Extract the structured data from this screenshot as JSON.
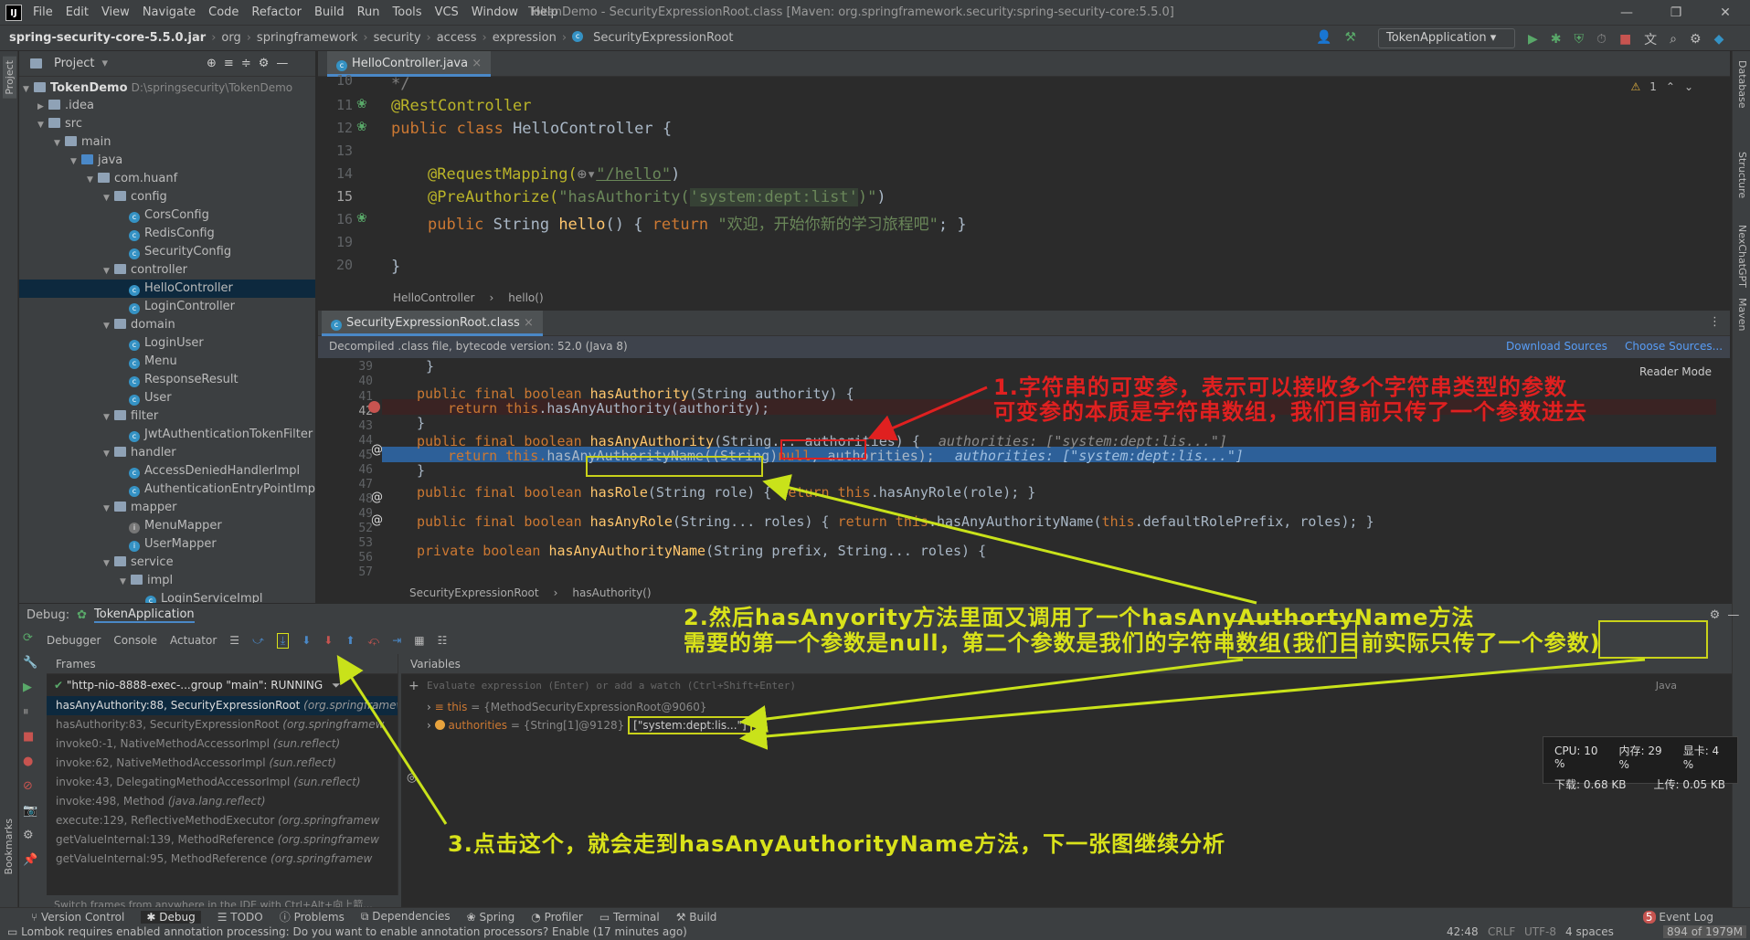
{
  "titlebar": {
    "logo": "IJ",
    "menus": [
      "File",
      "Edit",
      "View",
      "Navigate",
      "Code",
      "Refactor",
      "Build",
      "Run",
      "Tools",
      "VCS",
      "Window",
      "Help"
    ],
    "title": "TokenDemo - SecurityExpressionRoot.class [Maven: org.springframework.security:spring-security-core:5.5.0]"
  },
  "navbar": {
    "crumbs": [
      "spring-security-core-5.5.0.jar",
      "org",
      "springframework",
      "security",
      "access",
      "expression",
      "SecurityExpressionRoot"
    ],
    "run_config": "TokenApplication"
  },
  "project": {
    "title": "Project",
    "root": "TokenDemo",
    "root_path": "D:\\springsecurity\\TokenDemo",
    "items": [
      ".idea",
      "src",
      "main",
      "java",
      "com.huanf",
      "config",
      "CorsConfig",
      "RedisConfig",
      "SecurityConfig",
      "controller",
      "HelloController",
      "LoginController",
      "domain",
      "LoginUser",
      "Menu",
      "ResponseResult",
      "User",
      "filter",
      "JwtAuthenticationTokenFilter",
      "handler",
      "AccessDeniedHandlerImpl",
      "AuthenticationEntryPointImpl",
      "mapper",
      "MenuMapper",
      "UserMapper",
      "service",
      "impl",
      "LoginServiceImpl"
    ]
  },
  "editor1": {
    "tab": "HelloController.java",
    "lines": [
      "10",
      "11",
      "12",
      "13",
      "14",
      "15",
      "16",
      "19",
      "20"
    ],
    "code": {
      "l10": "*/",
      "l11": "@RestController",
      "l12a": "public class",
      "l12b": " HelloController {",
      "l14a": "@RequestMapping(",
      "l14b": "\"/hello\"",
      "l14c": ")",
      "l15a": "@PreAuthorize(",
      "l15b": "\"hasAuthority(",
      "l15c": "'system:dept:list'",
      "l15d": ")\"",
      "l15e": ")",
      "l16a": "public",
      "l16b": " String ",
      "l16c": "hello",
      "l16d": "() { ",
      "l16e": "return",
      "l16f": "\"欢迎，开始你新的学习旅程吧\"",
      "l16g": "; }",
      "l20": "}"
    },
    "breadcrumb": [
      "HelloController",
      "hello()"
    ],
    "warnings": "1"
  },
  "editor2": {
    "tab": "SecurityExpressionRoot.class",
    "decompiled": "Decompiled .class file, bytecode version: 52.0 (Java 8)",
    "download": "Download Sources",
    "choose": "Choose Sources...",
    "reader": "Reader Mode",
    "lines": [
      "39",
      "40",
      "41",
      "42",
      "43",
      "44",
      "45",
      "46",
      "47",
      "48",
      "49",
      "52",
      "53",
      "56",
      "57"
    ],
    "code": {
      "c39": "}",
      "c41a": "public final boolean ",
      "c41b": "hasAuthority",
      "c41c": "(String authority) {",
      "c42a": "return this",
      "c42b": ".hasAnyAuthority(authority);",
      "c43": "}",
      "c45a": "public final boolean ",
      "c45b": "hasAnyAuthority",
      "c45c": "(String... authorities) {",
      "c45d": "authorities: [\"system:dept:lis...\"]",
      "c46a": "return this.",
      "c46b": "hasAnyAuthorityName",
      "c46c": "((String)",
      "c46d": "null",
      "c46e": ", authorities);",
      "c46f": "authorities: [\"system:dept:lis...\"]",
      "c47": "}",
      "c49a": "public final boolean ",
      "c49b": "hasRole",
      "c49c": "(String role) { ",
      "c49d": "return this",
      "c49e": ".hasAnyRole(role); }",
      "c53a": "public final boolean ",
      "c53b": "hasAnyRole",
      "c53c": "(String... roles) { ",
      "c53d": "return this",
      "c53e": ".hasAnyAuthorityName(",
      "c53f": "this",
      ".c53g": "",
      "c53h": ".defaultRolePrefix, roles); }",
      "c57a": "private boolean ",
      "c57b": "hasAnyAuthorityName",
      "c57c": "(String prefix, String... roles) {"
    },
    "breadcrumb": [
      "SecurityExpressionRoot",
      "hasAuthority()"
    ]
  },
  "debug": {
    "label": "Debug:",
    "config": "TokenApplication",
    "tabs": [
      "Debugger",
      "Console",
      "Actuator"
    ],
    "frames_title": "Frames",
    "variables_title": "Variables",
    "thread": "\"http-nio-8888-exec-...group \"main\": RUNNING",
    "frames": [
      {
        "m": "hasAnyAuthority:88, SecurityExpressionRoot",
        "p": "(org.springframew"
      },
      {
        "m": "hasAuthority:83, SecurityExpressionRoot",
        "p": "(org.springframew"
      },
      {
        "m": "invoke0:-1, NativeMethodAccessorImpl",
        "p": "(sun.reflect)"
      },
      {
        "m": "invoke:62, NativeMethodAccessorImpl",
        "p": "(sun.reflect)"
      },
      {
        "m": "invoke:43, DelegatingMethodAccessorImpl",
        "p": "(sun.reflect)"
      },
      {
        "m": "invoke:498, Method",
        "p": "(java.lang.reflect)"
      },
      {
        "m": "execute:129, ReflectiveMethodExecutor",
        "p": "(org.springframew"
      },
      {
        "m": "getValueInternal:139, MethodReference",
        "p": "(org.springframew"
      },
      {
        "m": "getValueInternal:95, MethodReference",
        "p": "(org.springframew"
      }
    ],
    "frames_hint": "Switch frames from anywhere in the IDE with Ctrl+Alt+向上箭...",
    "eval_placeholder": "Evaluate expression (Enter) or add a watch (Ctrl+Shift+Enter)",
    "lang": "Java",
    "vars": [
      {
        "name": "this",
        "val": " = {MethodSecurityExpressionRoot@9060}"
      },
      {
        "name": "authorities",
        "val": " = {String[1]@9128}",
        "extra": "[\"system:dept:lis...\"]"
      }
    ]
  },
  "sysmon": {
    "cpu": "CPU: 10 %",
    "mem": "内存: 29 %",
    "gpu": "显卡: 4 %",
    "down": "下载: 0.68 KB",
    "up": "上传: 0.05 KB"
  },
  "toolstrip": [
    "Version Control",
    "Debug",
    "TODO",
    "Problems",
    "Dependencies",
    "Spring",
    "Profiler",
    "Terminal",
    "Build"
  ],
  "eventlog": "Event Log",
  "eventcount": "5",
  "status": {
    "msg": "Lombok requires enabled annotation processing: Do you want to enable annotation processors? Enable (17 minutes ago)",
    "pos": "42:48",
    "crlf": "CRLF",
    "enc": "UTF-8",
    "indent": "4 spaces",
    "mem": "894 of 1979M"
  },
  "annotations": {
    "red1": "1.字符串的可变参，表示可以接收多个字符串类型的参数",
    "red2": "可变参的本质是字符串数组，我们目前只传了一个参数进去",
    "y1": "2.然后hasAnyority方法里面又调用了一个hasAnyAuthortyName方法",
    "y2": "需要的第一个参数是null，第二个参数是我们的字符串数组(我们目前实际只传了一个参数)",
    "y3": "3.点击这个，就会走到hasAnyAuthorityName方法，下一张图继续分析"
  },
  "side": {
    "left_project": "Project",
    "left_bookmarks": "Bookmarks",
    "right": [
      "Database",
      "Structure",
      "NexChatGPT",
      "Maven"
    ]
  }
}
